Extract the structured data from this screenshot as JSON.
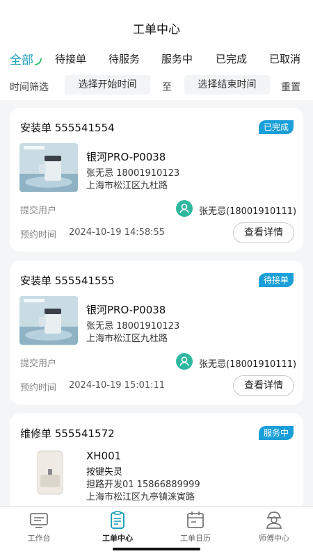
{
  "header": {
    "title": "工单中心"
  },
  "tabs": [
    {
      "label": "全部",
      "active": true
    },
    {
      "label": "待接单"
    },
    {
      "label": "待服务"
    },
    {
      "label": "服务中"
    },
    {
      "label": "已完成"
    },
    {
      "label": "已取消"
    }
  ],
  "filter": {
    "label": "时间筛选",
    "start_placeholder": "选择开始时间",
    "separator": "至",
    "end_placeholder": "选择结束时间",
    "reset_label": "重置"
  },
  "orders": [
    {
      "title": "安装单 555541554",
      "status": "已完成",
      "status_color": "#1a9fd8",
      "product": "银河PRO-P0038",
      "contact": "张无忌 18001910123",
      "address": "上海市松江区九杜路",
      "submitter_label": "提交用户",
      "submitter": "张无忌(18001910111)",
      "appointment_label": "预约时间",
      "appointment_time": "2024-10-19 14:58:55",
      "detail_button": "查看详情"
    },
    {
      "title": "安装单 555541555",
      "status": "待接单",
      "status_color": "#1a9fd8",
      "product": "银河PRO-P0038",
      "contact": "张无忌 18001910123",
      "address": "上海市松江区九杜路",
      "submitter_label": "提交用户",
      "submitter": "张无忌(18001910111)",
      "appointment_label": "预约时间",
      "appointment_time": "2024-10-19 15:01:11",
      "detail_button": "查看详情"
    },
    {
      "title": "维修单 555541572",
      "status": "服务中",
      "status_color": "#1a9fd8",
      "product": "XH001",
      "fault": "按键失灵",
      "contact": "担路开发01 15866889999",
      "address": "上海市松江区九亭镇涞寅路"
    }
  ],
  "bottom_nav": [
    {
      "label": "工作台",
      "icon": "workbench-icon"
    },
    {
      "label": "工单中心",
      "icon": "clipboard-icon",
      "active": true
    },
    {
      "label": "工单日历",
      "icon": "calendar-icon"
    },
    {
      "label": "师傅中心",
      "icon": "technician-icon"
    }
  ]
}
